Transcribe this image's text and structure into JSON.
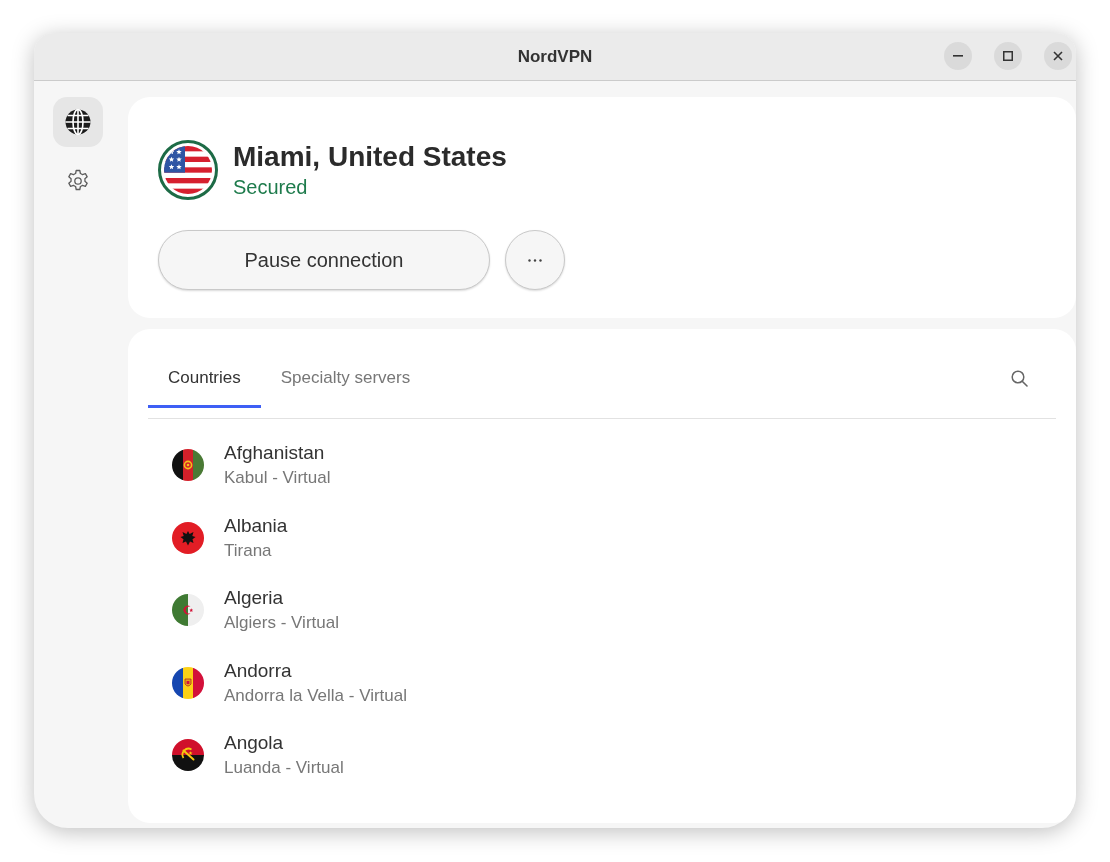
{
  "window": {
    "title": "NordVPN"
  },
  "sidebar": {
    "items": [
      {
        "kind": "globe",
        "selected": true
      },
      {
        "kind": "settings",
        "selected": false
      }
    ]
  },
  "connection": {
    "flag": {
      "kind": "usa"
    },
    "location": "Miami, United States",
    "status": "Secured",
    "pause_button": "Pause connection"
  },
  "tabs": [
    {
      "label": "Countries",
      "selected": true
    },
    {
      "label": "Specialty servers",
      "selected": false
    }
  ],
  "countries": [
    {
      "kind": "afghanistan",
      "name": "Afghanistan",
      "server": "Kabul - Virtual"
    },
    {
      "kind": "albania",
      "name": "Albania",
      "server": "Tirana"
    },
    {
      "kind": "algeria",
      "name": "Algeria",
      "server": "Algiers - Virtual"
    },
    {
      "kind": "andorra",
      "name": "Andorra",
      "server": "Andorra la Vella - Virtual"
    },
    {
      "kind": "angola",
      "name": "Angola",
      "server": "Luanda - Virtual"
    }
  ]
}
